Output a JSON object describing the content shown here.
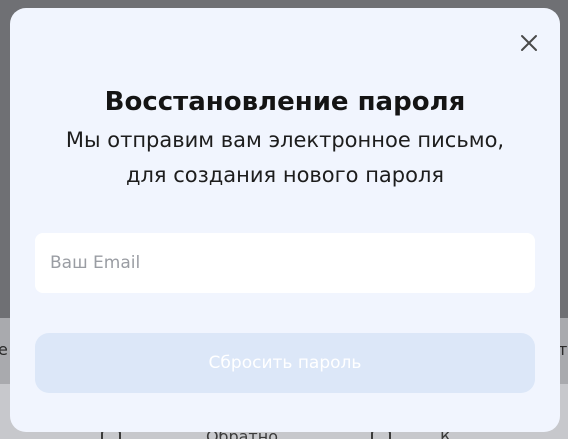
{
  "modal": {
    "title": "Восстановление пароля",
    "subtitle_line1": "Мы отправим вам электронное письмо,",
    "subtitle_line2": "для создания нового пароля",
    "email_placeholder": "Ваш Email",
    "email_value": "",
    "reset_button_label": "Сбросить пароль",
    "close_icon": "close-icon"
  },
  "background_page": {
    "left_fragment": "е",
    "right_fragment": "т",
    "bottom_word": "Обратно",
    "bottom_word_2": "К"
  },
  "colors": {
    "modal_background": "#f1f5fe",
    "button_disabled": "#dce7f8",
    "title_text": "#141414"
  }
}
